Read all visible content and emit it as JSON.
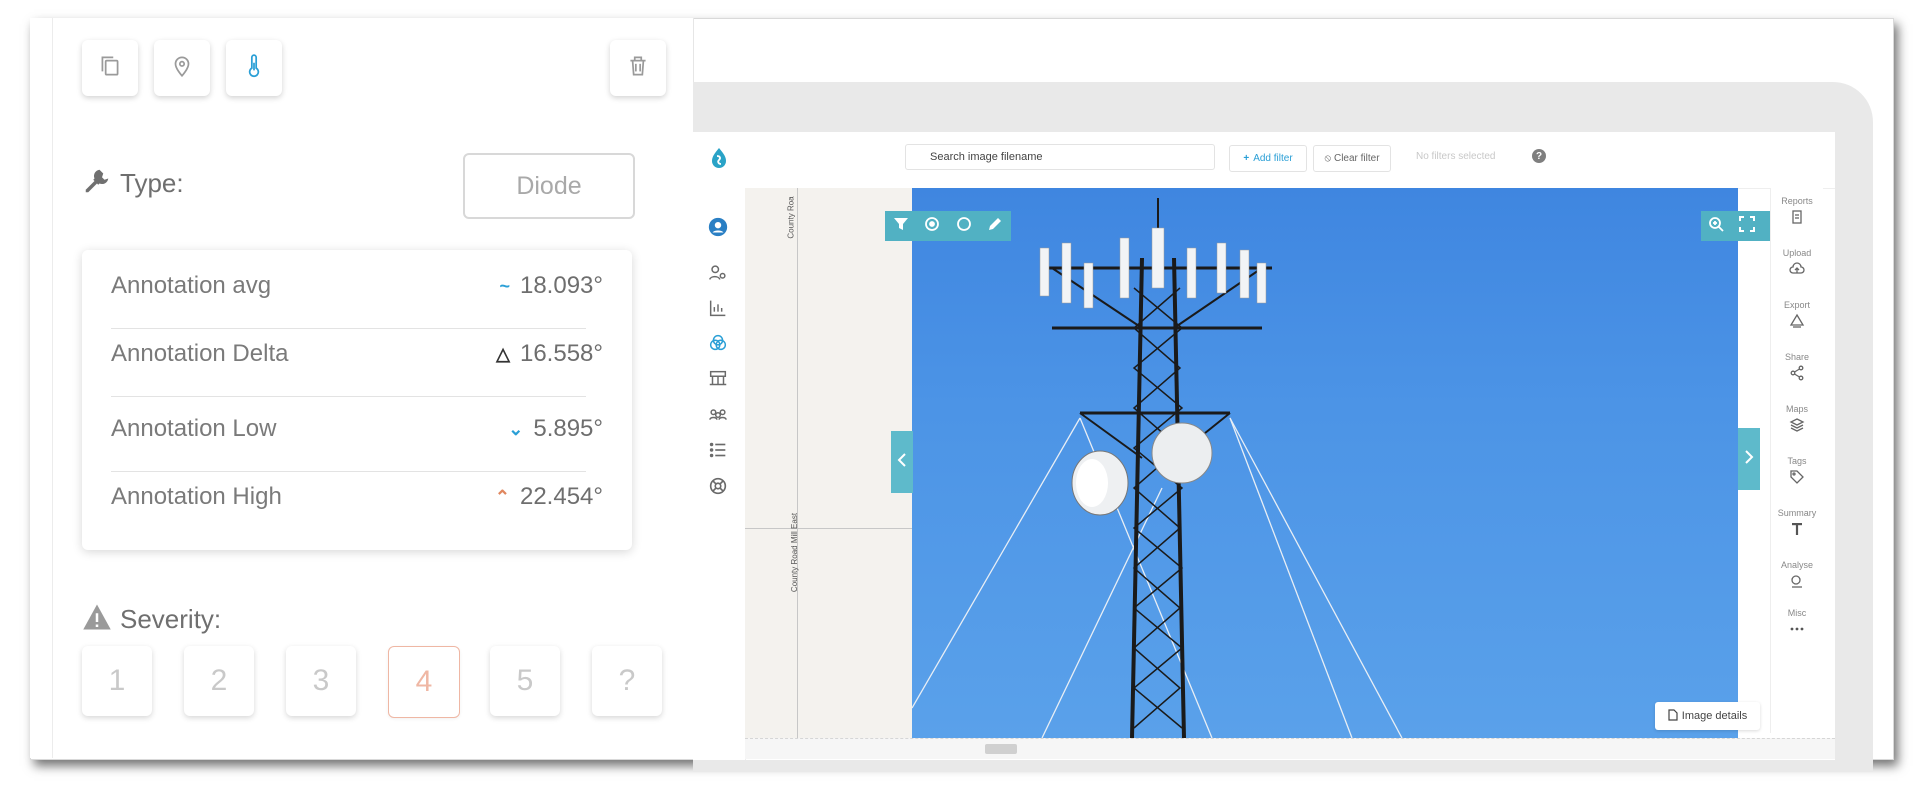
{
  "left_panel": {
    "toolbar": {
      "copy_icon": "copy-icon",
      "pin_icon": "map-pin-icon",
      "thermometer_icon": "thermometer-icon",
      "trash_icon": "trash-icon"
    },
    "type": {
      "label": "Type:",
      "value": "Diode"
    },
    "stats": [
      {
        "label": "Annotation avg",
        "symbol": "~",
        "value": "18.093°",
        "symbol_color": "#2a9fd6"
      },
      {
        "label": "Annotation Delta",
        "symbol": "△",
        "value": "16.558°",
        "symbol_color": "#333333"
      },
      {
        "label": "Annotation Low",
        "symbol": "⌄",
        "value": "5.895°",
        "symbol_color": "#2a9fd6"
      },
      {
        "label": "Annotation High",
        "symbol": "⌃",
        "value": "22.454°",
        "symbol_color": "#e0875f"
      }
    ],
    "severity": {
      "label": "Severity:",
      "options": [
        "1",
        "2",
        "3",
        "4",
        "5",
        "?"
      ],
      "selected": "4"
    }
  },
  "app": {
    "search_placeholder": "Search image filename",
    "add_filter": "Add filter",
    "clear_filter": "Clear filter",
    "no_filters": "No filters selected",
    "help": "?",
    "map_labels": [
      "County Roa",
      "County Road Mill East"
    ],
    "image_details": "Image details",
    "right_sidebar": [
      "Reports",
      "Upload",
      "Export",
      "Share",
      "Maps",
      "Tags",
      "Summary",
      "Analyse",
      "Misc"
    ],
    "accent_color": "#51b1c3",
    "sky_color": "#4a92e4"
  }
}
